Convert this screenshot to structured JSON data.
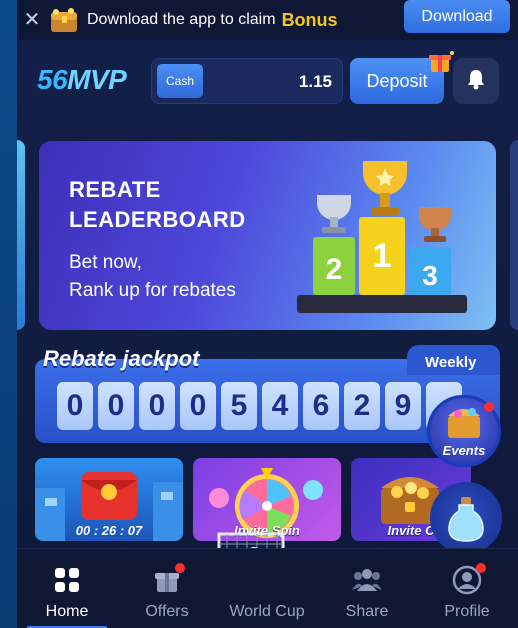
{
  "promo": {
    "close_icon": "close-icon",
    "text": "Download the app to claim",
    "highlight": "Bonus",
    "download_label": "Download"
  },
  "header": {
    "logo_number": "56",
    "logo_text": "MVP",
    "cash_label": "Cash",
    "balance": "1.15",
    "deposit_label": "Deposit"
  },
  "banner": {
    "title_line1": "REBATE",
    "title_line2": "LEADERBOARD",
    "sub_line1": "Bet now,",
    "sub_line2": "Rank up for rebates",
    "podium_labels": [
      "2",
      "1",
      "3"
    ]
  },
  "jackpot": {
    "title": "Rebate jackpot",
    "period": "Weekly",
    "digits": [
      "0",
      "0",
      "0",
      "0",
      "5",
      "4",
      "6",
      "2",
      "9",
      "."
    ]
  },
  "cards": {
    "card1_timer": "00 : 26 : 07",
    "card2_label": "Invite Spin",
    "card3_label": "Invite C"
  },
  "floating": {
    "events_label": "Events"
  },
  "nav": {
    "items": [
      {
        "label": "Home",
        "icon": "home-grid-icon"
      },
      {
        "label": "Offers",
        "icon": "gift-icon"
      },
      {
        "label": "World Cup",
        "icon": "soccer-goal-icon"
      },
      {
        "label": "Share",
        "icon": "users-icon"
      },
      {
        "label": "Profile",
        "icon": "profile-icon"
      }
    ]
  },
  "colors": {
    "accent": "#3d7df0",
    "bonus": "#f7c51c",
    "badge": "#ff2d2d"
  }
}
